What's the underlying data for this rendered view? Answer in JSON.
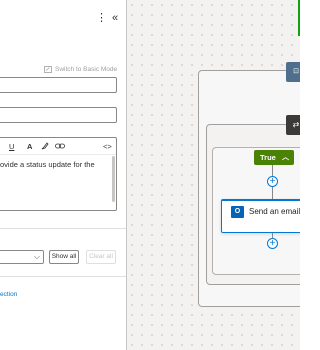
{
  "panel": {
    "more_icon": "more-vertical-icon",
    "collapse_icon": "double-chevron-left-icon",
    "switch_mode_label": "Switch to Basic Mode",
    "toolbar": {
      "underline": "U",
      "text_color": "A",
      "highlight_icon": "highlight-icon",
      "link_icon": "link-icon",
      "code_view": "<>"
    },
    "body_text_line1": "ovide a status update for the",
    "show_all_label": "Show all",
    "clear_all_label": "Clear all",
    "link_text": "ection"
  },
  "canvas": {
    "true_label": "True",
    "email_action_title": "Send an email",
    "colors": {
      "accent": "#0078d4",
      "true_branch": "#498205",
      "green_connector": "#13a10e"
    }
  }
}
